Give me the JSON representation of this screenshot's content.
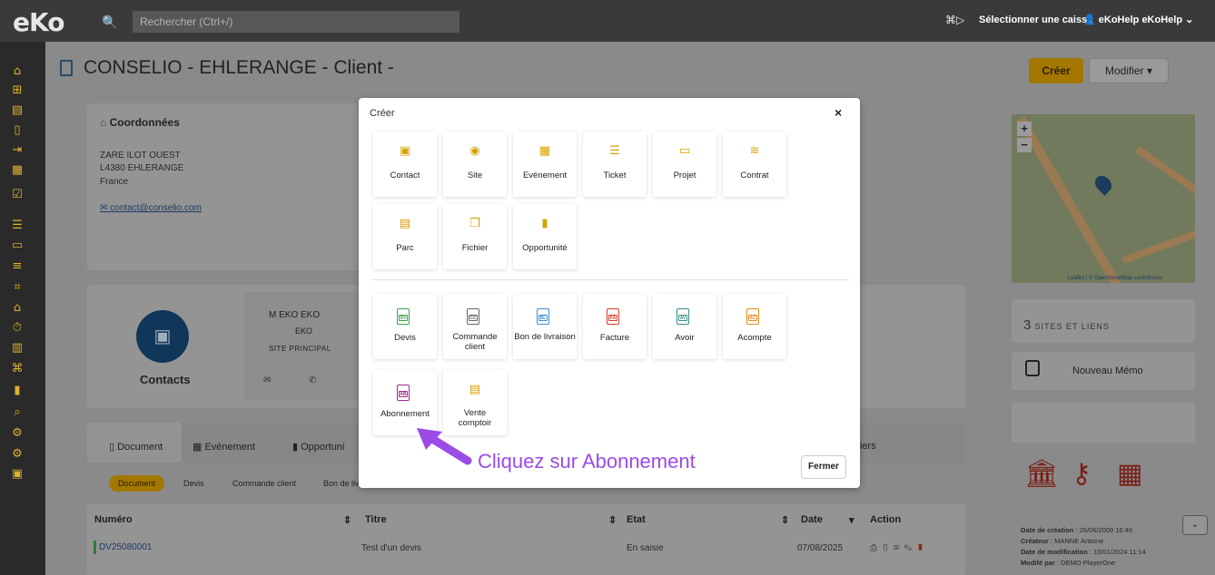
{
  "topbar": {
    "logo": "eKo",
    "search_placeholder": "Rechercher (Ctrl+/)",
    "cashier_icon": "⌘▷",
    "cashier_label": "Sélectionner une caisse",
    "user_label": "eKoHelp eKoHelp"
  },
  "page": {
    "title": "CONSELIO - EHLERANGE - Client -",
    "create_label": "Créer",
    "modify_label": "Modifier"
  },
  "coordinates": {
    "title": "Coordonnées",
    "address1": "ZARE ILOT OUEST",
    "address2": "L4380 EHLERANGE",
    "country": "France",
    "email": "contact@conselio.com"
  },
  "contacts": {
    "label": "Contacts",
    "name": "M EKO EKO",
    "company": "EKO",
    "site": "SITE PRINCIPAL"
  },
  "tabs": [
    "Document",
    "Evénement",
    "Opportuni",
    "iers"
  ],
  "filters": [
    "Document",
    "Devis",
    "Commande client",
    "Bon de liv"
  ],
  "table": {
    "headers": [
      "Numéro",
      "Titre",
      "Etat",
      "Date",
      "Action"
    ],
    "row": {
      "number": "DV25080001",
      "title": "Test d'un devis",
      "state": "En saisie",
      "date": "07/08/2025"
    }
  },
  "right_panel": {
    "map_attribution": "Leaflet | © OpenStreetMap contributors",
    "sites_count": "3",
    "sites_label": "SITES ET LIENS",
    "memo_label": "Nouveau Mémo",
    "created_label": "Date de création",
    "created_value": " : 26/06/2009 16:46",
    "creator_label": "Créateur",
    "creator_value": " : MANNE Antoine",
    "modified_label": "Date de modification",
    "modified_value": " : 10/01/2024 11:14",
    "modified_by_label": "Modifé par",
    "modified_by_value": " : DEMO PlayerOne"
  },
  "modal": {
    "title": "Créer",
    "close_label": "×",
    "close_button": "Fermer",
    "items_top": [
      "Contact",
      "Site",
      "Evénement",
      "Ticket",
      "Projet",
      "Contrat",
      "Parc",
      "Fichier",
      "Opportunité"
    ],
    "items_docs": [
      "Devis",
      "Commande client",
      "Bon de livraison",
      "Facture",
      "Avoir",
      "Acompte",
      "Abonnement",
      "Vente comptoir"
    ],
    "doc_codes": [
      "DV",
      "CC",
      "BL",
      "FA",
      "AV",
      "AC",
      "AB",
      ""
    ]
  },
  "hint": {
    "text": "Cliquez sur Abonnement"
  },
  "colors": {
    "accent": "#d4a300",
    "hint": "#9b4be6",
    "brand_dark": "#3a3a3a"
  }
}
